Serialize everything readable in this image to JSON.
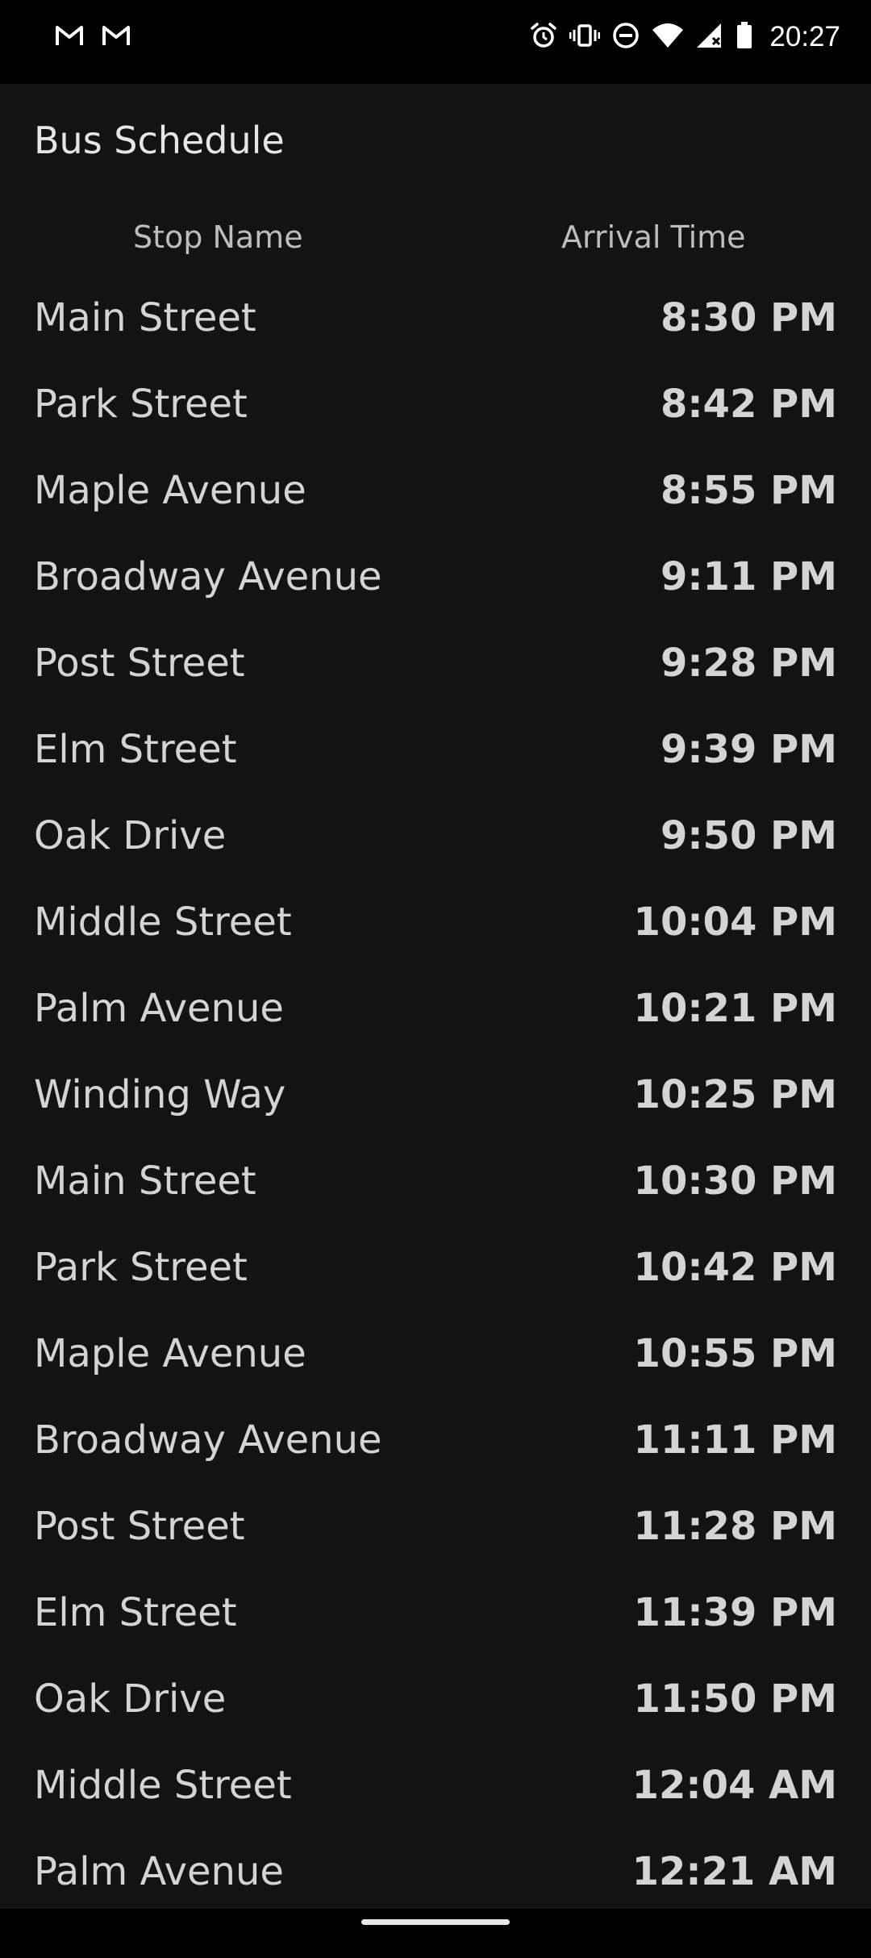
{
  "status_bar": {
    "time": "20:27",
    "left_icons": [
      "gmail-icon",
      "gmail-icon"
    ],
    "right_icons": [
      "alarm-icon",
      "vibrate-icon",
      "do-not-disturb-icon",
      "wifi-icon",
      "signal-icon",
      "battery-icon"
    ]
  },
  "app": {
    "title": "Bus Schedule",
    "columns": {
      "stop": "Stop Name",
      "arrival": "Arrival Time"
    },
    "rows": [
      {
        "stop": "Main Street",
        "time": "8:30 PM"
      },
      {
        "stop": "Park Street",
        "time": "8:42 PM"
      },
      {
        "stop": "Maple Avenue",
        "time": "8:55 PM"
      },
      {
        "stop": "Broadway Avenue",
        "time": "9:11 PM"
      },
      {
        "stop": "Post Street",
        "time": "9:28 PM"
      },
      {
        "stop": "Elm Street",
        "time": "9:39 PM"
      },
      {
        "stop": "Oak Drive",
        "time": "9:50 PM"
      },
      {
        "stop": "Middle Street",
        "time": "10:04 PM"
      },
      {
        "stop": "Palm Avenue",
        "time": "10:21 PM"
      },
      {
        "stop": "Winding Way",
        "time": "10:25 PM"
      },
      {
        "stop": "Main Street",
        "time": "10:30 PM"
      },
      {
        "stop": "Park Street",
        "time": "10:42 PM"
      },
      {
        "stop": "Maple Avenue",
        "time": "10:55 PM"
      },
      {
        "stop": "Broadway Avenue",
        "time": "11:11 PM"
      },
      {
        "stop": "Post Street",
        "time": "11:28 PM"
      },
      {
        "stop": "Elm Street",
        "time": "11:39 PM"
      },
      {
        "stop": "Oak Drive",
        "time": "11:50 PM"
      },
      {
        "stop": "Middle Street",
        "time": "12:04 AM"
      },
      {
        "stop": "Palm Avenue",
        "time": "12:21 AM"
      }
    ]
  }
}
